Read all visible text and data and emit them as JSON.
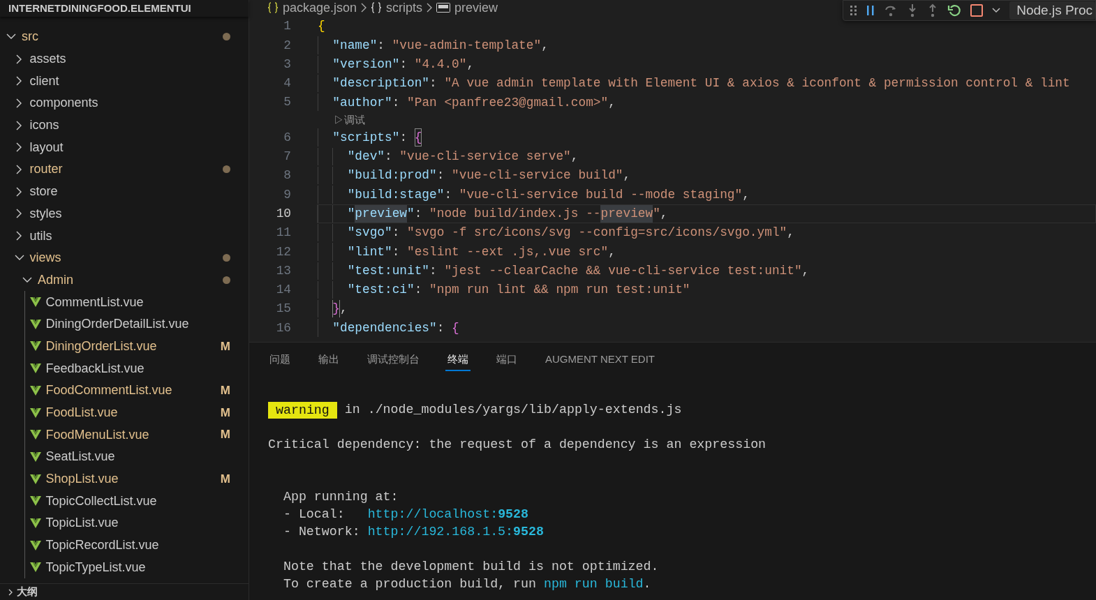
{
  "explorer": {
    "title": "INTERNETDININGFOOD.ELEMENTUI",
    "tree": [
      {
        "kind": "folder",
        "label": "src",
        "expanded": true,
        "modified": true,
        "children": [
          {
            "kind": "folder",
            "label": "assets",
            "expanded": false,
            "modified": false
          },
          {
            "kind": "folder",
            "label": "client",
            "expanded": false,
            "modified": false
          },
          {
            "kind": "folder",
            "label": "components",
            "expanded": false,
            "modified": false
          },
          {
            "kind": "folder",
            "label": "icons",
            "expanded": false,
            "modified": false
          },
          {
            "kind": "folder",
            "label": "layout",
            "expanded": false,
            "modified": false
          },
          {
            "kind": "folder",
            "label": "router",
            "expanded": false,
            "modified": true
          },
          {
            "kind": "folder",
            "label": "store",
            "expanded": false,
            "modified": false
          },
          {
            "kind": "folder",
            "label": "styles",
            "expanded": false,
            "modified": false
          },
          {
            "kind": "folder",
            "label": "utils",
            "expanded": false,
            "modified": false
          },
          {
            "kind": "folder",
            "label": "views",
            "expanded": true,
            "modified": true,
            "children": [
              {
                "kind": "folder",
                "label": "Admin",
                "expanded": true,
                "modified": true,
                "children": [
                  {
                    "kind": "file",
                    "label": "CommentList.vue",
                    "modified": false
                  },
                  {
                    "kind": "file",
                    "label": "DiningOrderDetailList.vue",
                    "modified": false
                  },
                  {
                    "kind": "file",
                    "label": "DiningOrderList.vue",
                    "modified": true,
                    "badge": "M"
                  },
                  {
                    "kind": "file",
                    "label": "FeedbackList.vue",
                    "modified": false
                  },
                  {
                    "kind": "file",
                    "label": "FoodCommentList.vue",
                    "modified": true,
                    "badge": "M"
                  },
                  {
                    "kind": "file",
                    "label": "FoodList.vue",
                    "modified": true,
                    "badge": "M"
                  },
                  {
                    "kind": "file",
                    "label": "FoodMenuList.vue",
                    "modified": true,
                    "badge": "M"
                  },
                  {
                    "kind": "file",
                    "label": "SeatList.vue",
                    "modified": false
                  },
                  {
                    "kind": "file",
                    "label": "ShopList.vue",
                    "modified": true,
                    "badge": "M"
                  },
                  {
                    "kind": "file",
                    "label": "TopicCollectList.vue",
                    "modified": false
                  },
                  {
                    "kind": "file",
                    "label": "TopicList.vue",
                    "modified": false
                  },
                  {
                    "kind": "file",
                    "label": "TopicRecordList.vue",
                    "modified": false
                  },
                  {
                    "kind": "file",
                    "label": "TopicTypeList.vue",
                    "modified": false
                  }
                ]
              }
            ]
          }
        ]
      }
    ],
    "outline_title": "大纲"
  },
  "breadcrumb": [
    {
      "kind": "json",
      "label": "package.json"
    },
    {
      "kind": "object",
      "label": "scripts"
    },
    {
      "kind": "string",
      "label": "preview"
    }
  ],
  "debug_toolbar": {
    "session": "Node.js Proc"
  },
  "editor": {
    "lines": [
      {
        "number": "1",
        "current": false,
        "tokens": [
          {
            "kind": "brace-gold",
            "t": "{"
          }
        ]
      },
      {
        "number": "2",
        "current": false,
        "tokens": [
          {
            "kind": "indent"
          },
          {
            "kind": "key",
            "t": "\"name\""
          },
          {
            "kind": "punct",
            "t": ": "
          },
          {
            "kind": "str",
            "t": "\"vue-admin-template\""
          },
          {
            "kind": "punct",
            "t": ","
          }
        ]
      },
      {
        "number": "3",
        "current": false,
        "tokens": [
          {
            "kind": "indent"
          },
          {
            "kind": "key",
            "t": "\"version\""
          },
          {
            "kind": "punct",
            "t": ": "
          },
          {
            "kind": "str",
            "t": "\"4.4.0\""
          },
          {
            "kind": "punct",
            "t": ","
          }
        ]
      },
      {
        "number": "4",
        "current": false,
        "tokens": [
          {
            "kind": "indent"
          },
          {
            "kind": "key",
            "t": "\"description\""
          },
          {
            "kind": "punct",
            "t": ": "
          },
          {
            "kind": "str",
            "t": "\"A vue admin template with Element UI & axios & iconfont & permission control & lint"
          }
        ]
      },
      {
        "number": "5",
        "current": false,
        "tokens": [
          {
            "kind": "indent"
          },
          {
            "kind": "key",
            "t": "\"author\""
          },
          {
            "kind": "punct",
            "t": ": "
          },
          {
            "kind": "str",
            "t": "\"Pan <panfree23@gmail.com>\""
          },
          {
            "kind": "punct",
            "t": ","
          }
        ],
        "codelens": "▷调试"
      },
      {
        "number": "6",
        "current": false,
        "tokens": [
          {
            "kind": "indent"
          },
          {
            "kind": "key",
            "t": "\"scripts\""
          },
          {
            "kind": "punct",
            "t": ": "
          },
          {
            "kind": "brace-match",
            "t": "{"
          }
        ]
      },
      {
        "number": "7",
        "current": false,
        "tokens": [
          {
            "kind": "indent"
          },
          {
            "kind": "indent"
          },
          {
            "kind": "key",
            "t": "\"dev\""
          },
          {
            "kind": "punct",
            "t": ": "
          },
          {
            "kind": "str",
            "t": "\"vue-cli-service serve\""
          },
          {
            "kind": "punct",
            "t": ","
          }
        ]
      },
      {
        "number": "8",
        "current": false,
        "tokens": [
          {
            "kind": "indent"
          },
          {
            "kind": "indent"
          },
          {
            "kind": "key",
            "t": "\"build:prod\""
          },
          {
            "kind": "punct",
            "t": ": "
          },
          {
            "kind": "str",
            "t": "\"vue-cli-service build\""
          },
          {
            "kind": "punct",
            "t": ","
          }
        ]
      },
      {
        "number": "9",
        "current": false,
        "tokens": [
          {
            "kind": "indent"
          },
          {
            "kind": "indent"
          },
          {
            "kind": "key",
            "t": "\"build:stage\""
          },
          {
            "kind": "punct",
            "t": ": "
          },
          {
            "kind": "str",
            "t": "\"vue-cli-service build --mode staging\""
          },
          {
            "kind": "punct",
            "t": ","
          }
        ]
      },
      {
        "number": "10",
        "current": true,
        "tokens": [
          {
            "kind": "indent"
          },
          {
            "kind": "indent"
          },
          {
            "kind": "key",
            "t": "\""
          },
          {
            "kind": "key-hl",
            "t": "preview"
          },
          {
            "kind": "key",
            "t": "\""
          },
          {
            "kind": "punct",
            "t": ": "
          },
          {
            "kind": "str",
            "t": "\"node build/index.js --"
          },
          {
            "kind": "str-hl",
            "t": "preview"
          },
          {
            "kind": "str",
            "t": "\""
          },
          {
            "kind": "punct",
            "t": ","
          }
        ]
      },
      {
        "number": "11",
        "current": false,
        "tokens": [
          {
            "kind": "indent"
          },
          {
            "kind": "indent"
          },
          {
            "kind": "key",
            "t": "\"svgo\""
          },
          {
            "kind": "punct",
            "t": ": "
          },
          {
            "kind": "str",
            "t": "\"svgo -f src/icons/svg --config=src/icons/svgo.yml\""
          },
          {
            "kind": "punct",
            "t": ","
          }
        ]
      },
      {
        "number": "12",
        "current": false,
        "tokens": [
          {
            "kind": "indent"
          },
          {
            "kind": "indent"
          },
          {
            "kind": "key",
            "t": "\"lint\""
          },
          {
            "kind": "punct",
            "t": ": "
          },
          {
            "kind": "str",
            "t": "\"eslint --ext .js,.vue src\""
          },
          {
            "kind": "punct",
            "t": ","
          }
        ]
      },
      {
        "number": "13",
        "current": false,
        "tokens": [
          {
            "kind": "indent"
          },
          {
            "kind": "indent"
          },
          {
            "kind": "key",
            "t": "\"test:unit\""
          },
          {
            "kind": "punct",
            "t": ": "
          },
          {
            "kind": "str",
            "t": "\"jest --clearCache && vue-cli-service test:unit\""
          },
          {
            "kind": "punct",
            "t": ","
          }
        ]
      },
      {
        "number": "14",
        "current": false,
        "tokens": [
          {
            "kind": "indent"
          },
          {
            "kind": "indent"
          },
          {
            "kind": "key",
            "t": "\"test:ci\""
          },
          {
            "kind": "punct",
            "t": ": "
          },
          {
            "kind": "str",
            "t": "\"npm run lint && npm run test:unit\""
          }
        ]
      },
      {
        "number": "15",
        "current": false,
        "tokens": [
          {
            "kind": "indent"
          },
          {
            "kind": "brace-match",
            "t": "}"
          },
          {
            "kind": "punct",
            "t": ","
          }
        ]
      },
      {
        "number": "16",
        "current": false,
        "tokens": [
          {
            "kind": "indent"
          },
          {
            "kind": "key",
            "t": "\"dependencies\""
          },
          {
            "kind": "punct",
            "t": ": "
          },
          {
            "kind": "brace-pink",
            "t": "{"
          }
        ]
      }
    ]
  },
  "panel": {
    "tabs": [
      {
        "label": "问题",
        "selected": false
      },
      {
        "label": "输出",
        "selected": false
      },
      {
        "label": "调试控制台",
        "selected": false
      },
      {
        "label": "终端",
        "selected": true
      },
      {
        "label": "端口",
        "selected": false
      },
      {
        "label": "AUGMENT NEXT EDIT",
        "selected": false
      }
    ],
    "terminal": [
      {
        "kind": "line",
        "segments": [
          {
            "kind": "badge",
            "t": "warning"
          },
          {
            "kind": "text",
            "t": " in ./node_modules/yargs/lib/apply-extends.js"
          }
        ]
      },
      {
        "kind": "blank"
      },
      {
        "kind": "line",
        "segments": [
          {
            "kind": "text",
            "t": "Critical dependency: the request of a dependency is an expression"
          }
        ]
      },
      {
        "kind": "blank"
      },
      {
        "kind": "blank"
      },
      {
        "kind": "line",
        "segments": [
          {
            "kind": "text",
            "t": "  App running at:"
          }
        ]
      },
      {
        "kind": "line",
        "segments": [
          {
            "kind": "text",
            "t": "  - Local:   "
          },
          {
            "kind": "link",
            "t": "http://localhost:**9528**"
          }
        ]
      },
      {
        "kind": "line",
        "segments": [
          {
            "kind": "text",
            "t": "  - Network: "
          },
          {
            "kind": "link",
            "t": "http://192.168.1.5:**9528**"
          }
        ]
      },
      {
        "kind": "blank"
      },
      {
        "kind": "line",
        "segments": [
          {
            "kind": "text",
            "t": "  Note that the development build is not optimized."
          }
        ]
      },
      {
        "kind": "line",
        "segments": [
          {
            "kind": "text",
            "t": "  To create a production build, run "
          },
          {
            "kind": "link",
            "t": "npm run build"
          },
          {
            "kind": "text",
            "t": "."
          }
        ]
      }
    ]
  }
}
